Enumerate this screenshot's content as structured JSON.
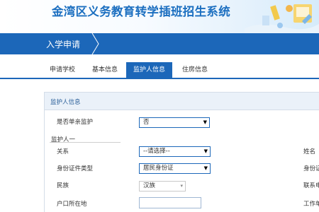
{
  "header": {
    "title": "金湾区义务教育转学插班招生系统"
  },
  "nav": {
    "current": "入学申请"
  },
  "tabs": [
    {
      "label": "申请学校",
      "active": false
    },
    {
      "label": "基本信息",
      "active": false
    },
    {
      "label": "监护人信息",
      "active": true
    },
    {
      "label": "住房信息",
      "active": false
    }
  ],
  "panel": {
    "title": "监护人信息",
    "single_parent": {
      "label": "是否单亲监护",
      "value": "否"
    },
    "guardian_section": "监护人一",
    "relation": {
      "label": "关系",
      "value": "--请选择--"
    },
    "id_type": {
      "label": "身份证件类型",
      "value": "居民身份证"
    },
    "ethnicity": {
      "label": "民族",
      "value": "汉族"
    },
    "household": {
      "label": "户口所在地",
      "value": ""
    },
    "right_labels": {
      "name": "姓名",
      "id_number": "身份证",
      "contact": "联系电",
      "work": "工作单"
    }
  },
  "colors": {
    "primary": "#1c67b9",
    "title": "#1c6fc0"
  }
}
